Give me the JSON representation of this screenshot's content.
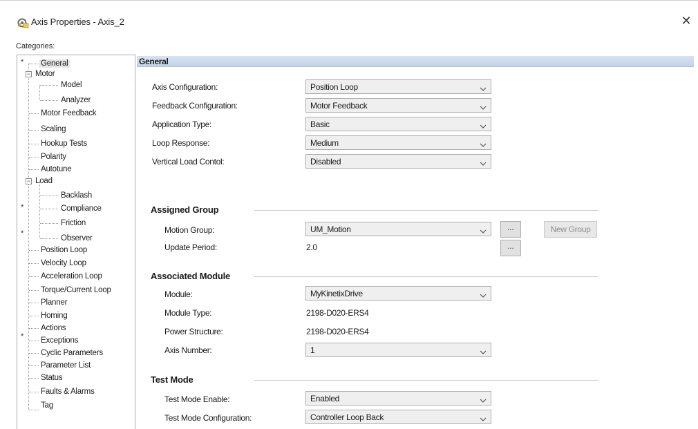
{
  "window": {
    "title": "Axis Properties - Axis_2",
    "title_icon": "axis-properties-icon",
    "close_glyph": "✕"
  },
  "categories": {
    "label": "Categories:",
    "items": [
      {
        "label": "General",
        "selected": true,
        "starred": true
      },
      {
        "label": "Motor",
        "expander": "−"
      },
      {
        "label": "Model"
      },
      {
        "label": "Analyzer"
      },
      {
        "label": "Motor Feedback"
      },
      {
        "label": "Scaling"
      },
      {
        "label": "Hookup Tests"
      },
      {
        "label": "Polarity"
      },
      {
        "label": "Autotune"
      },
      {
        "label": "Load",
        "expander": "−"
      },
      {
        "label": "Backlash"
      },
      {
        "label": "Compliance",
        "starred": true
      },
      {
        "label": "Friction"
      },
      {
        "label": "Observer",
        "starred": true
      },
      {
        "label": "Position Loop"
      },
      {
        "label": "Velocity Loop"
      },
      {
        "label": "Acceleration Loop"
      },
      {
        "label": "Torque/Current Loop"
      },
      {
        "label": "Planner"
      },
      {
        "label": "Homing"
      },
      {
        "label": "Actions"
      },
      {
        "label": "Exceptions",
        "starred": true
      },
      {
        "label": "Cyclic Parameters"
      },
      {
        "label": "Parameter List"
      },
      {
        "label": "Status"
      },
      {
        "label": "Faults & Alarms"
      },
      {
        "label": "Tag"
      }
    ],
    "star_glyph": "*"
  },
  "general": {
    "header": "General",
    "fields": [
      {
        "label": "Axis Configuration:",
        "value": "Position Loop"
      },
      {
        "label": "Feedback Configuration:",
        "value": "Motor Feedback"
      },
      {
        "label": "Application Type:",
        "value": "Basic"
      },
      {
        "label": "Loop Response:",
        "value": "Medium"
      },
      {
        "label": "Vertical Load Contol:",
        "value": "Disabled"
      }
    ]
  },
  "assigned_group": {
    "title": "Assigned Group",
    "motion_group_label": "Motion Group:",
    "motion_group_value": "UM_Motion",
    "update_period_label": "Update Period:",
    "update_period_value": "2.0",
    "ellipsis": "...",
    "new_group_label": "New Group"
  },
  "associated_module": {
    "title": "Associated Module",
    "module_label": "Module:",
    "module_value": "MyKinetixDrive",
    "module_type_label": "Module Type:",
    "module_type_value": "2198-D020-ERS4",
    "power_structure_label": "Power Structure:",
    "power_structure_value": "2198-D020-ERS4",
    "axis_number_label": "Axis Number:",
    "axis_number_value": "1"
  },
  "test_mode": {
    "title": "Test Mode",
    "enable_label": "Test Mode Enable:",
    "enable_value": "Enabled",
    "config_label": "Test Mode Configuration:",
    "config_value": "Controller Loop Back"
  },
  "icons": {
    "dropdown": "chevron-down-icon",
    "close": "close-icon"
  }
}
